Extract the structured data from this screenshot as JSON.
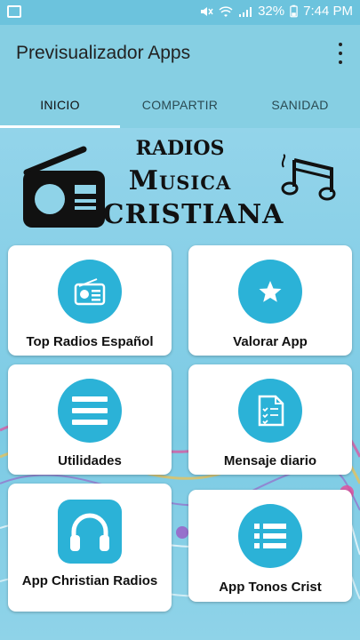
{
  "status": {
    "battery": "32%",
    "time": "7:44 PM"
  },
  "appbar": {
    "title": "Previsualizador Apps"
  },
  "tabs": [
    {
      "label": "INICIO"
    },
    {
      "label": "COMPARTIR"
    },
    {
      "label": "SANIDAD"
    }
  ],
  "banner": {
    "line1": "RADIOS",
    "line2": "Musica",
    "line3": "CRISTIANA"
  },
  "cards": [
    {
      "label": "Top Radios Español",
      "icon": "radio-icon"
    },
    {
      "label": "Valorar App",
      "icon": "star-icon"
    },
    {
      "label": "Utilidades",
      "icon": "menu-lines-icon"
    },
    {
      "label": "Mensaje diario",
      "icon": "checklist-document-icon"
    },
    {
      "label": "App Christian Radios",
      "icon": "headphones-icon"
    },
    {
      "label": "App Tonos Crist",
      "icon": "list-icon"
    }
  ],
  "colors": {
    "appbar": "#86cfe3",
    "accent": "#2bb2d7",
    "card": "#ffffff"
  }
}
